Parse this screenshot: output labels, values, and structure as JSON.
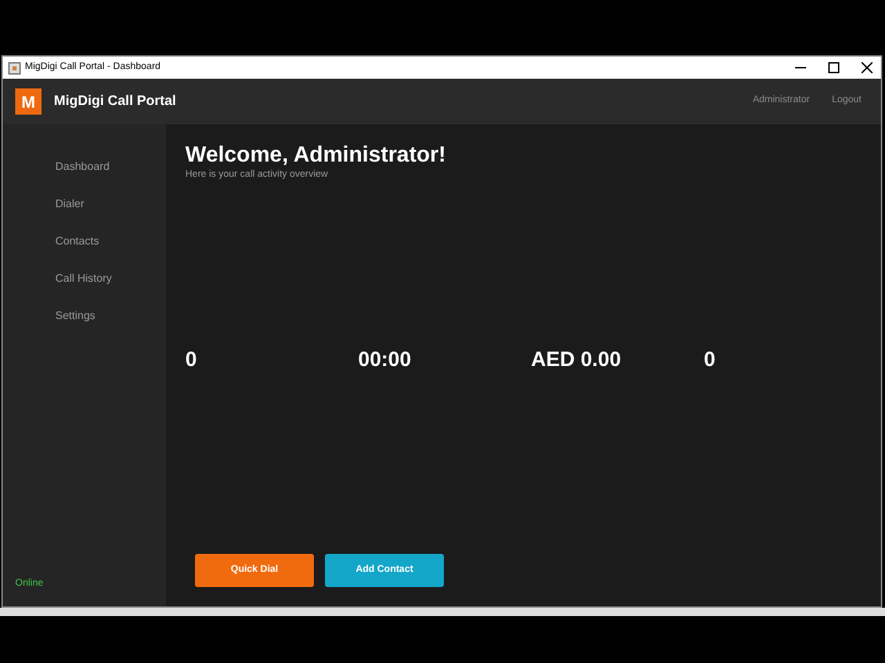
{
  "window": {
    "title": "MigDigi Call Portal - Dashboard"
  },
  "header": {
    "logo": "M",
    "app_name": "MigDigi Call Portal",
    "user": "Administrator",
    "logout": "Logout"
  },
  "sidebar": {
    "items": [
      {
        "label": "Dashboard"
      },
      {
        "label": "Dialer"
      },
      {
        "label": "Contacts"
      },
      {
        "label": "Call History"
      },
      {
        "label": "Settings"
      }
    ],
    "status": "Online"
  },
  "main": {
    "title": "Welcome, Administrator!",
    "subtitle": "Here is your call activity overview",
    "stats": [
      {
        "value": "0"
      },
      {
        "value": "00:00"
      },
      {
        "value": "AED 0.00"
      },
      {
        "value": "0"
      }
    ],
    "buttons": [
      {
        "label": "Quick Dial",
        "color": "#f06a0e"
      },
      {
        "label": "Add Contact",
        "color": "#14a6c9"
      }
    ]
  }
}
